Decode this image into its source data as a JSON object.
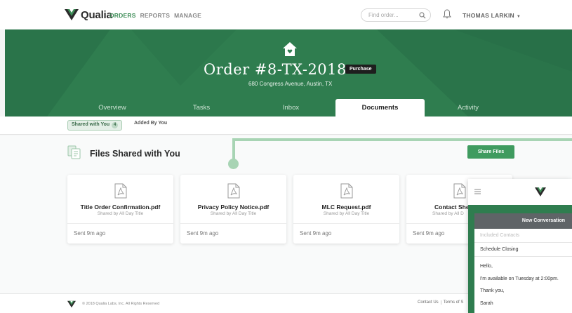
{
  "nav": {
    "brand": "Qualia",
    "links": [
      "ORDERS",
      "REPORTS",
      "MANAGE"
    ],
    "search_placeholder": "Find order...",
    "user": "THOMAS LARKIN"
  },
  "header": {
    "order_title": "Order #8-TX-2018",
    "badge": "Purchase",
    "address": "680 Congress Avenue, Austin, TX"
  },
  "tabs": [
    "Overview",
    "Tasks",
    "Inbox",
    "Documents",
    "Activity"
  ],
  "subtabs": {
    "shared": "Shared with You",
    "shared_count": "4",
    "added": "Added By You"
  },
  "files": {
    "title": "Files Shared with You",
    "share_button": "Share Files",
    "cards": [
      {
        "name": "Title Order Confirmation.pdf",
        "shared_by": "Shared by All Day Title",
        "sent": "Sent 9m ago"
      },
      {
        "name": "Privacy Policy Notice.pdf",
        "shared_by": "Shared by All Day Title",
        "sent": "Sent 9m ago"
      },
      {
        "name": "MLC Request.pdf",
        "shared_by": "Shared by All Day Title",
        "sent": "Sent 9m ago"
      },
      {
        "name": "Contact She",
        "shared_by": "Shared by All D",
        "sent": "Sent 9m ago"
      }
    ]
  },
  "footer": {
    "copyright": "© 2018 Qualia Labs, Inc. All Rights Reserved",
    "links": [
      "Contact Us",
      "Terms of S"
    ]
  },
  "chat": {
    "header": "New Conversation",
    "contacts_placeholder": "Included Contacts",
    "subject": "Schedule Closing",
    "message_lines": [
      "Hello,",
      "I'm available on Tuesday at 2:00pm.",
      "Thank you,",
      "Sarah"
    ]
  },
  "colors": {
    "brand_green": "#2f7d4f",
    "accent_green": "#3f9b5f",
    "connector_green": "#a8d4b4"
  }
}
